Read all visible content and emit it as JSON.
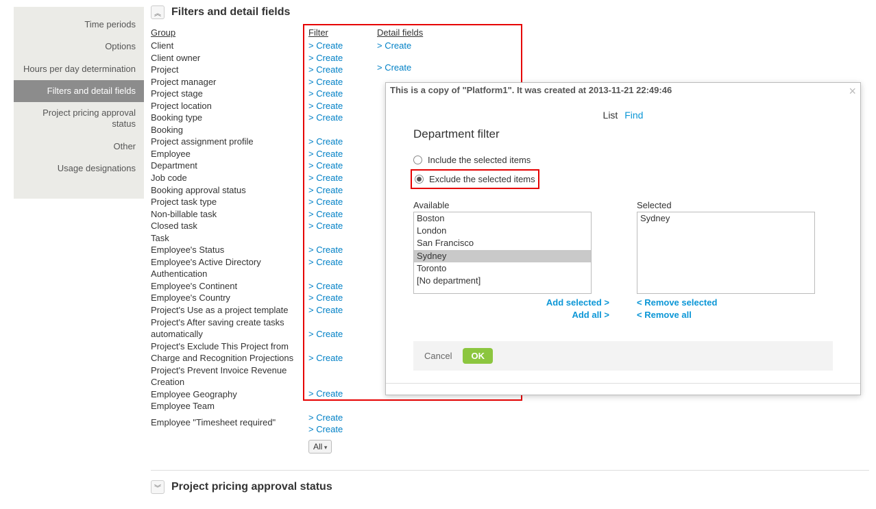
{
  "sidebar": {
    "items": [
      {
        "label": "Time periods"
      },
      {
        "label": "Options"
      },
      {
        "label": "Hours per day determination"
      },
      {
        "label": "Filters and detail fields",
        "active": true
      },
      {
        "label": "Project pricing approval status"
      },
      {
        "label": "Other"
      },
      {
        "label": "Usage designations"
      }
    ]
  },
  "section": {
    "title": "Filters and detail fields",
    "group_header": "Group",
    "filter_header": "Filter",
    "detail_header": "Detail fields",
    "create_label": "> Create",
    "groups": [
      "Client",
      "Client owner",
      "Project",
      "Project manager",
      "Project stage",
      "Project location",
      "Booking type",
      "Booking",
      "Project assignment profile",
      "Employee",
      "Department",
      "Job code",
      "Booking approval status",
      "Project task type",
      "Non-billable task",
      "Closed task",
      "Task",
      "Employee's Status",
      "Employee's Active Directory Authentication",
      "Employee's Continent",
      "Employee's Country",
      "Project's Use as a project template",
      "Project's After saving create tasks automatically",
      "Project's Exclude This Project from Charge and Recognition Projections",
      "Project's Prevent Invoice Revenue Creation",
      "Employee Geography",
      "Employee Team"
    ],
    "filter_has_create": [
      true,
      true,
      true,
      true,
      true,
      true,
      true,
      false,
      true,
      true,
      true,
      true,
      true,
      true,
      true,
      true,
      false,
      true,
      true,
      true,
      true,
      true,
      true,
      true,
      true,
      true,
      true
    ],
    "last_group_label": "Employee \"Timesheet required\"",
    "select_value": "All"
  },
  "next_section_title": "Project pricing approval status",
  "modal": {
    "copy_text": "This is a copy of \"Platform1\". It was created at 2013-11-21 22:49:46",
    "tabs": {
      "active": "List",
      "other": "Find"
    },
    "title": "Department filter",
    "radio_include": "Include the selected items",
    "radio_exclude": "Exclude the selected items",
    "available_label": "Available",
    "selected_label": "Selected",
    "available": [
      "Boston",
      "London",
      "San Francisco",
      "Sydney",
      "Toronto",
      "[No department]"
    ],
    "available_selected_index": 3,
    "selected": [
      "Sydney"
    ],
    "actions": {
      "add_selected": "Add selected >",
      "add_all": "Add all >",
      "remove_selected": "< Remove selected",
      "remove_all": "< Remove all"
    },
    "cancel": "Cancel",
    "ok": "OK"
  }
}
